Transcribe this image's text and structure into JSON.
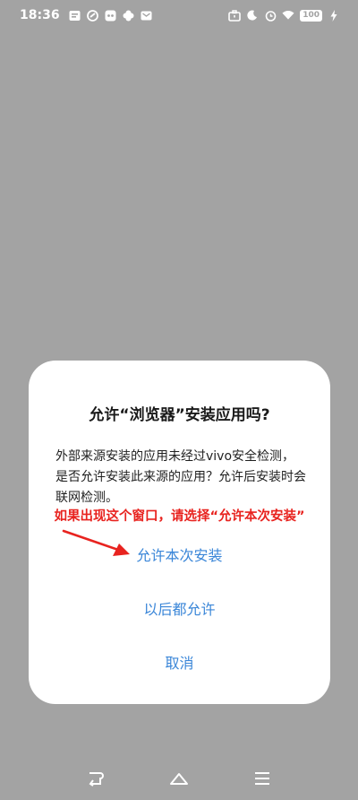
{
  "status_bar": {
    "time": "18:36",
    "battery": "100",
    "left_icons": [
      "gallery-icon",
      "sync-icon",
      "app-icon",
      "fan-icon",
      "mail-icon"
    ],
    "right_icons": [
      "briefcase-icon",
      "moon-icon",
      "alarm-icon",
      "wifi-icon",
      "battery-icon",
      "charging-icon"
    ]
  },
  "dialog": {
    "title": "允许“浏览器”安装应用吗?",
    "message": "外部来源安装的应用未经过vivo安全检测，是否允许安装此来源的应用？允许后安装时会联网检测。",
    "annotation": "如果出现这个窗口，请选择“允许本次安装”",
    "buttons": {
      "allow_once": "允许本次安装",
      "allow_always": "以后都允许",
      "cancel": "取消"
    }
  },
  "colors": {
    "overlay": "#a3a3a3",
    "dialog_bg": "#ffffff",
    "button_text": "#3a86d8",
    "annotation": "#e8231f"
  },
  "nav_bar": {
    "icons": [
      "back-icon",
      "home-icon",
      "menu-icon"
    ]
  }
}
